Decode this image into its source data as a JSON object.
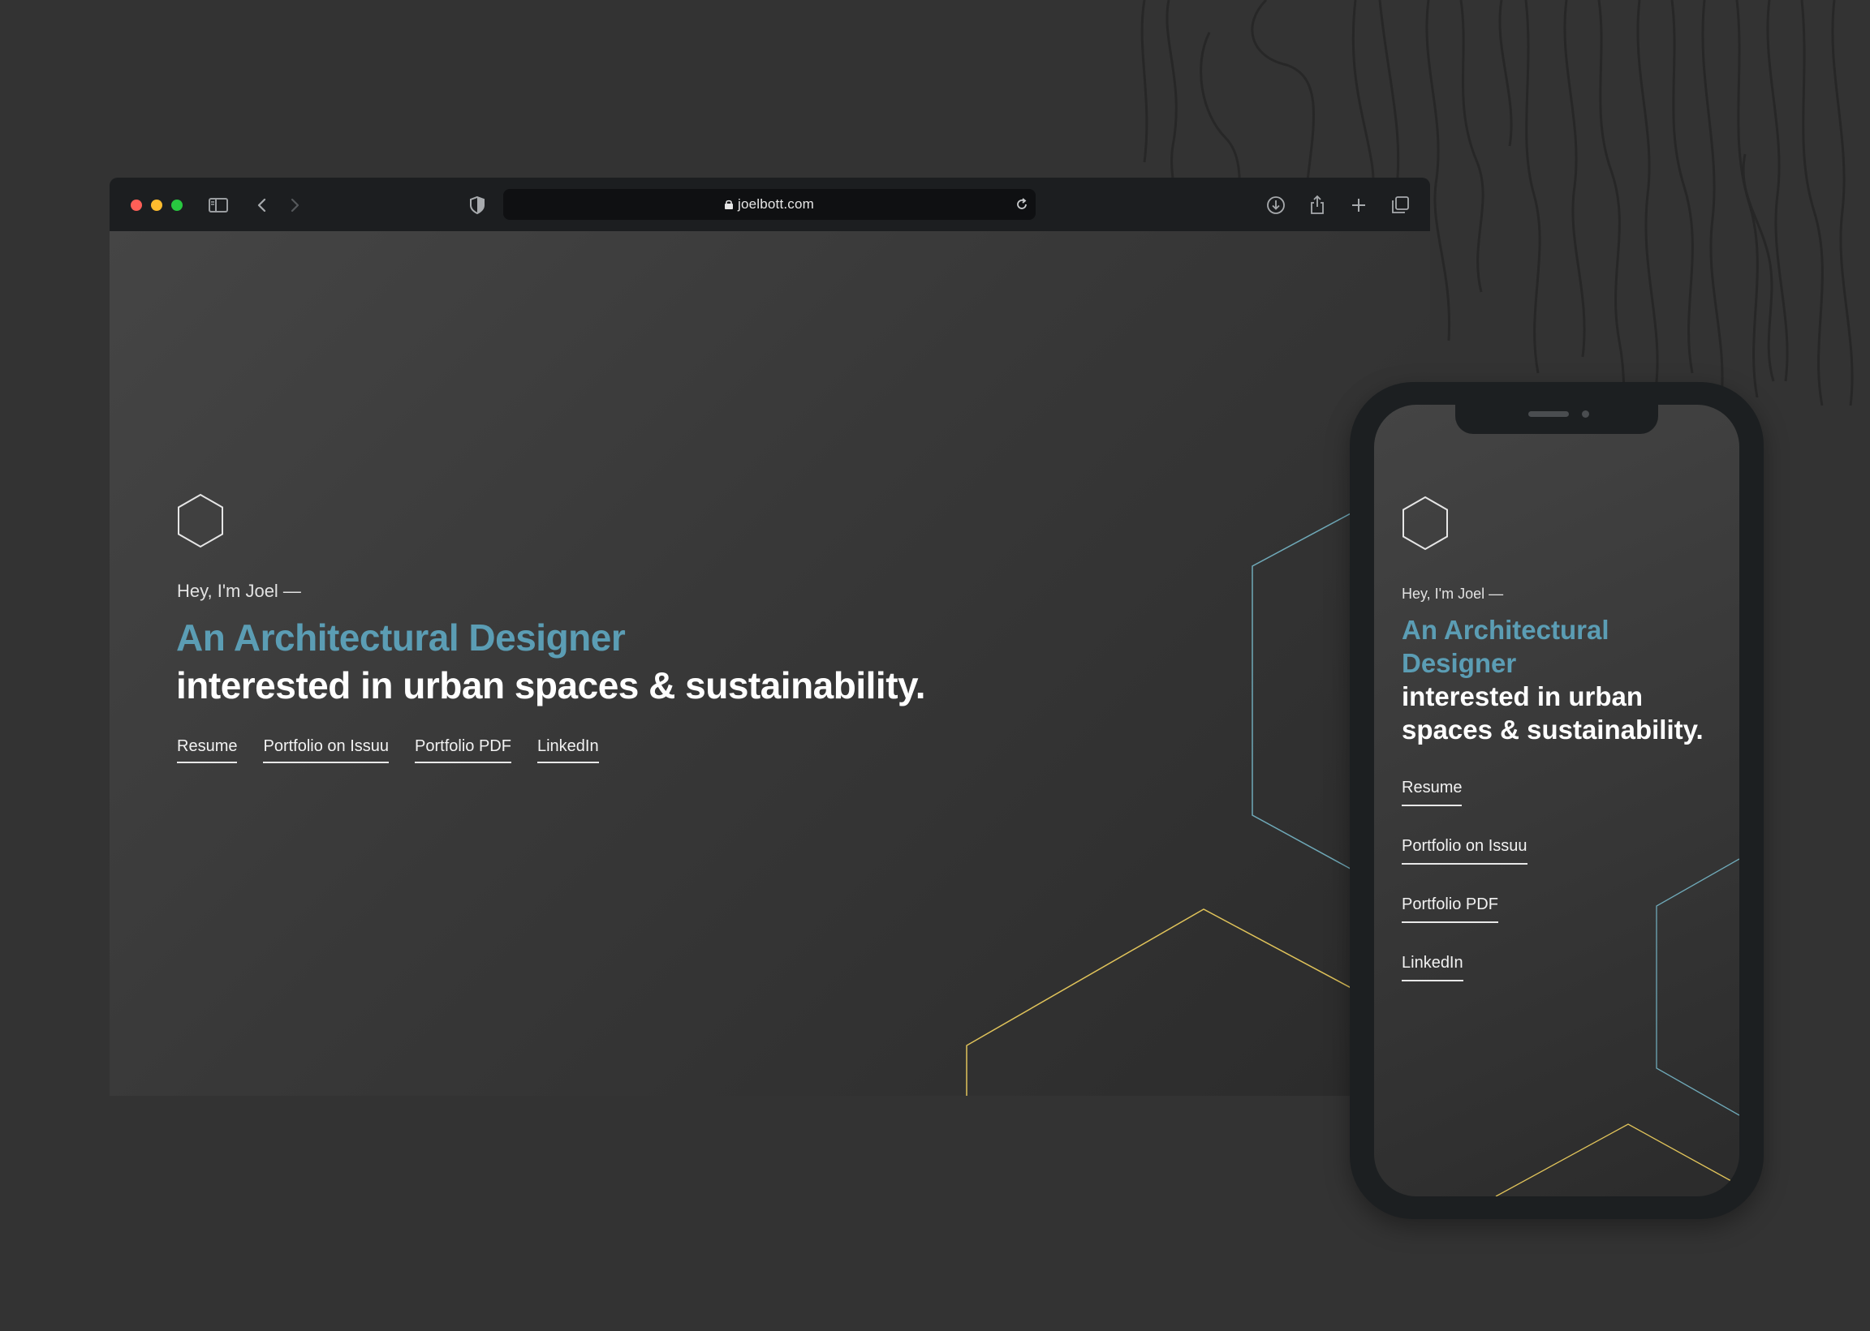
{
  "browser": {
    "url": "joelbott.com",
    "toolbar_icons": [
      "close-dot",
      "minimize-dot",
      "zoom-dot",
      "sidebar-icon",
      "back-icon",
      "forward-icon",
      "privacy-shield-icon",
      "lock-icon",
      "reload-icon",
      "download-icon",
      "share-icon",
      "new-tab-icon",
      "tab-overview-icon"
    ]
  },
  "site": {
    "greeting": "Hey, I'm Joel —",
    "headline_accent": "An Architectural Designer",
    "headline_rest": "interested in urban spaces & sustainability.",
    "links": {
      "resume": "Resume",
      "issuu": "Portfolio on Issuu",
      "pdf": "Portfolio PDF",
      "linkedin": "LinkedIn"
    },
    "logo_icon": "hexagon-icon"
  },
  "colors": {
    "page_bg": "#333333",
    "accent_blue": "#5b9db4",
    "accent_yellow": "#e0c35a",
    "hex_teal": "#6fa9b8",
    "toolbar": "#1c1e20"
  }
}
